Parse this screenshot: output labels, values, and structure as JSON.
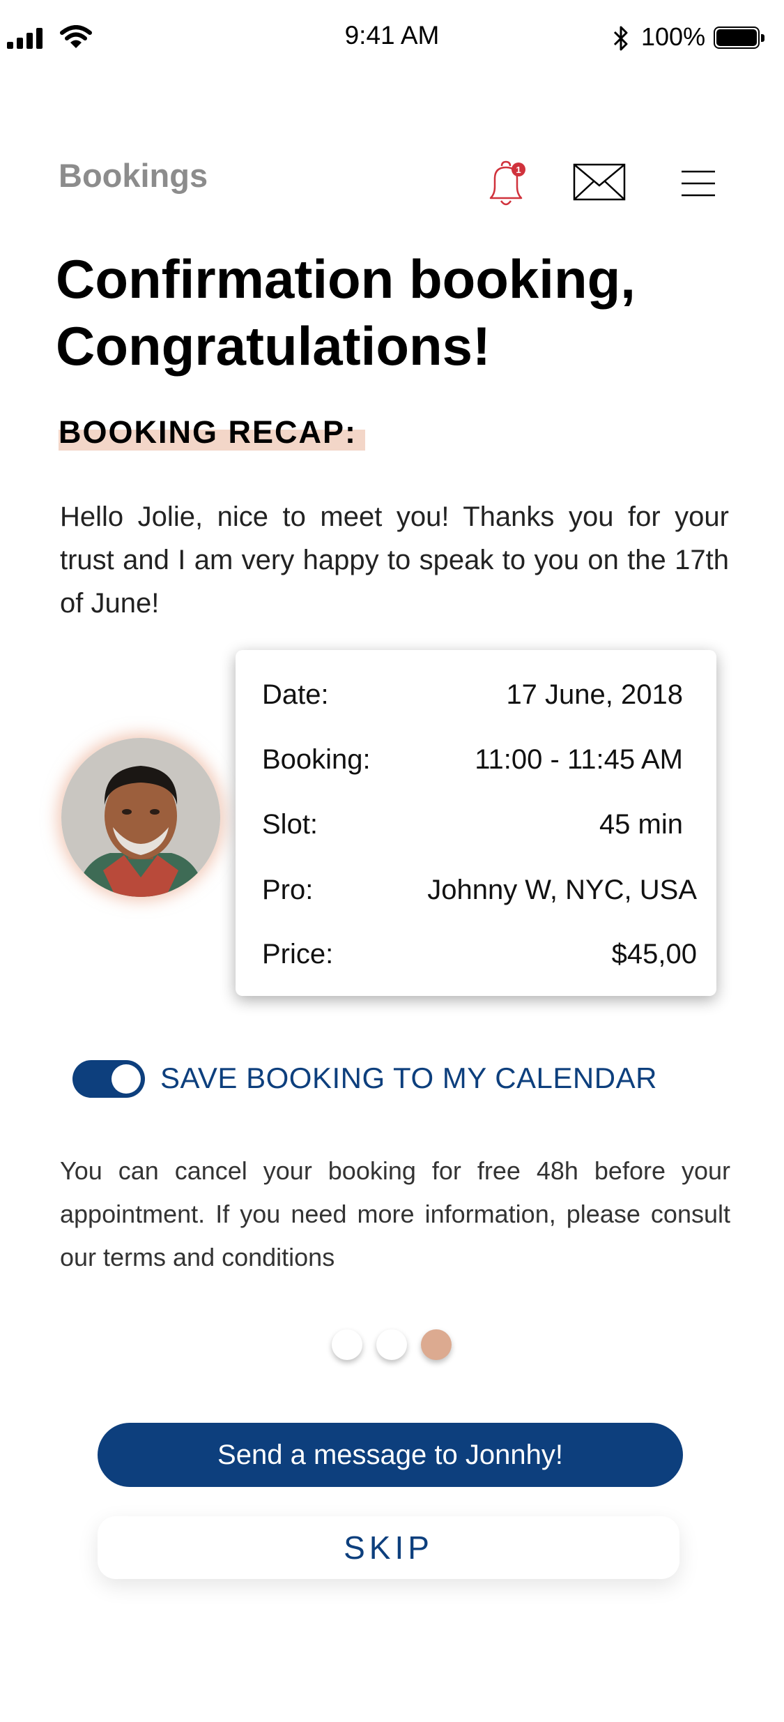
{
  "status_bar": {
    "time": "9:41 AM",
    "battery": "100%"
  },
  "header": {
    "title": "Bookings",
    "notification_count": "1",
    "icons": {
      "notifications": "bell-icon",
      "messages": "mail-icon",
      "menu": "menu-icon"
    },
    "bell_color": "#d0323c"
  },
  "headline_line1": "Confirmation booking,",
  "headline_line2": "Congratulations!",
  "recap_label": "BOOKING RECAP:",
  "intro_text": "Hello Jolie, nice to meet you! Thanks you for your trust and I am very happy to speak to you on the 17th of June!",
  "booking": {
    "rows": [
      {
        "label": "Date:",
        "value": "17 June, 2018"
      },
      {
        "label": "Booking:",
        "value": "11:00 - 11:45 AM"
      },
      {
        "label": "Slot:",
        "value": "45 min"
      },
      {
        "label": "Pro:",
        "value": "Johnny W, NYC, USA"
      },
      {
        "label": "Price:",
        "value": "$45,00"
      }
    ]
  },
  "calendar_toggle": {
    "label": "SAVE BOOKING TO MY CALENDAR",
    "on": true
  },
  "cancel_note": "You can cancel your booking for free 48h before your appointment. If you need more information, please consult our terms and conditions",
  "pagination": {
    "count": 3,
    "active": 3
  },
  "actions": {
    "primary": "Send a message to Jonnhy!",
    "skip": "SKIP"
  },
  "colors": {
    "primary": "#0d3f7d",
    "accent": "#dcaa90",
    "highlight": "#f3d6c8",
    "brand_gray": "#8c8c8c"
  }
}
